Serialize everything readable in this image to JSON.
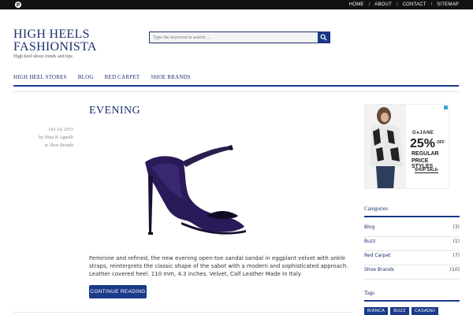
{
  "topbar": {
    "pin_icon": "pinterest-icon",
    "nav": [
      "HOME",
      "ABOUT",
      "CONTACT",
      "SITEMAP"
    ]
  },
  "header": {
    "title_line1": "HIGH HEELS",
    "title_line2": "FASHIONISTA",
    "tagline": "High heel shoes trends and tips"
  },
  "search": {
    "placeholder": "Type the keyword to search ..."
  },
  "mainnav": [
    "HIGH HEEL STORES",
    "BLOG",
    "RED CARPET",
    "SHOE BRANDS"
  ],
  "post": {
    "title": "EVENING",
    "date": "Oct 14, 2015",
    "author": "by Nina R Agnelli",
    "category": "in Shoe Brands",
    "excerpt": "Feminine and refined, the new evening open-toe sandal sandal in eggplant velvet with ankle straps, reinterprets the classic shape of the sabot with a modern and sophisticated approach. Leather covered heel. 110 mm, 4.3 inches. Velvet, Calf Leather Made In Italy",
    "read_more": "CONTINUE READING"
  },
  "ad": {
    "brand": "G●JANE",
    "percent": "25%",
    "off": "OFF",
    "line1": "REGULAR",
    "line2": "PRICE STYLES",
    "cta": "SHOP SALE›"
  },
  "sidebar": {
    "categories_title": "Categories",
    "categories": [
      {
        "name": "Blog",
        "count": "(3)"
      },
      {
        "name": "Buzz",
        "count": "(1)"
      },
      {
        "name": "Red Carpet",
        "count": "(7)"
      },
      {
        "name": "Shoe Brands",
        "count": "(10)"
      }
    ],
    "tags_title": "Tags",
    "tags": [
      "BIANCA",
      "BUZZ",
      "CASADEI"
    ]
  },
  "colors": {
    "accent": "#1a3a8a",
    "title": "#1a2f6e",
    "topbar": "#111111"
  }
}
